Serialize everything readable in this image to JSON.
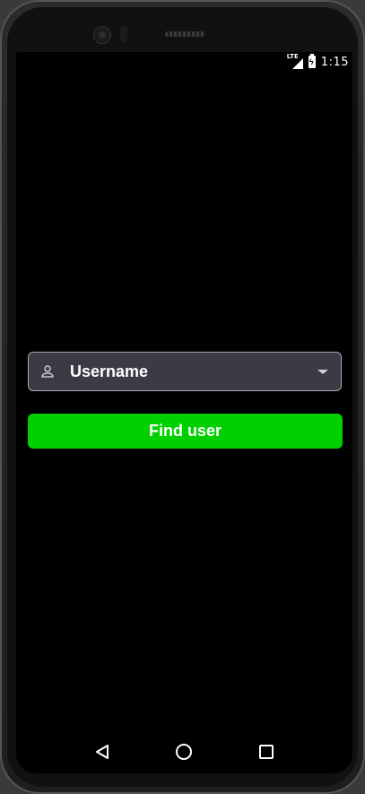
{
  "status_bar": {
    "network": "LTE",
    "time": "1:15"
  },
  "form": {
    "username_dropdown": {
      "value": "Username",
      "icon": "person-icon"
    },
    "find_button_label": "Find user"
  },
  "colors": {
    "background": "#000000",
    "field_bg": "#3b3b45",
    "field_border": "#a8a8ae",
    "button_green": "#00d000",
    "text": "#ffffff"
  },
  "nav_bar": {
    "back": "back-triangle-icon",
    "home": "home-circle-icon",
    "recents": "recents-square-icon"
  }
}
